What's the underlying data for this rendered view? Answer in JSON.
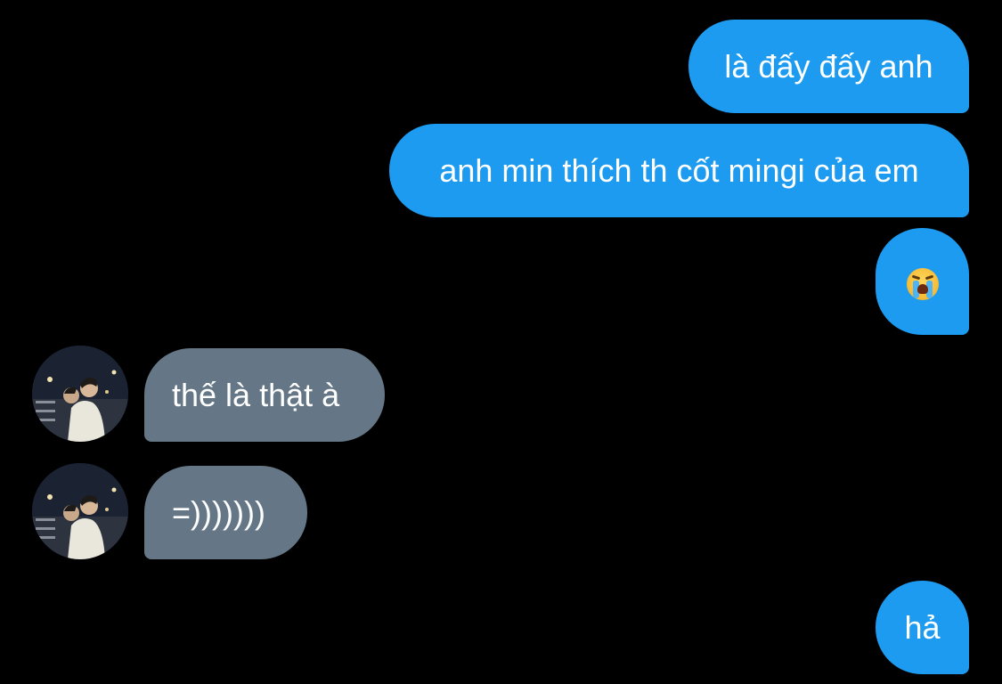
{
  "messages": [
    {
      "sender": "me",
      "text": "là đấy đấy anh"
    },
    {
      "sender": "me",
      "text": "anh min thích th cốt mingi của em"
    },
    {
      "sender": "me",
      "emoji": "loudly-crying-face-emoji"
    },
    {
      "sender": "other",
      "text": "thế là thật à"
    },
    {
      "sender": "other",
      "text": "=)))))))"
    },
    {
      "sender": "me",
      "text": "hả"
    }
  ],
  "colors": {
    "background": "#000000",
    "sent_bubble": "#1d9bf0",
    "received_bubble": "#657786",
    "text": "#ffffff"
  }
}
